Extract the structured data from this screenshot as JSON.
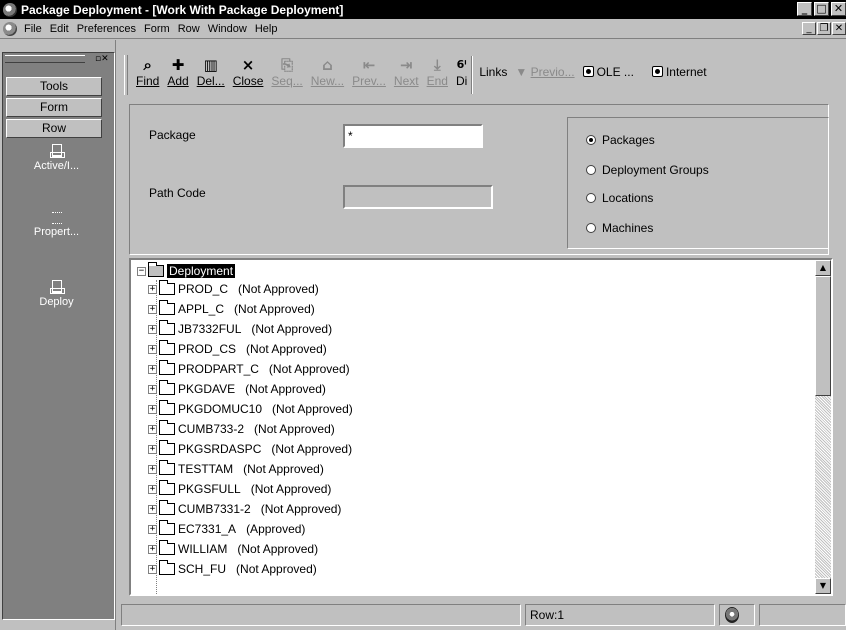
{
  "window": {
    "title": "Package Deployment - [Work With Package Deployment]"
  },
  "menu": [
    "File",
    "Edit",
    "Preferences",
    "Form",
    "Row",
    "Window",
    "Help"
  ],
  "exit_bar": {
    "tabs": [
      "Tools",
      "Form",
      "Row"
    ],
    "items": [
      "Active/I...",
      "Propert...",
      "Deploy"
    ]
  },
  "toolbar": {
    "buttons": [
      {
        "label": "Find",
        "icon": "find-icon",
        "enabled": true
      },
      {
        "label": "Add",
        "icon": "add-icon",
        "enabled": true
      },
      {
        "label": "Del...",
        "icon": "delete-icon",
        "enabled": true
      },
      {
        "label": "Close",
        "icon": "close-icon",
        "enabled": true
      },
      {
        "label": "Seq...",
        "icon": "sequence-icon",
        "enabled": false
      },
      {
        "label": "New...",
        "icon": "new-icon",
        "enabled": false
      },
      {
        "label": "Prev...",
        "icon": "prev-icon",
        "enabled": false
      },
      {
        "label": "Next",
        "icon": "next-icon",
        "enabled": false
      },
      {
        "label": "End",
        "icon": "end-icon",
        "enabled": false
      },
      {
        "label": "Di",
        "icon": "display-icon",
        "enabled": true
      }
    ],
    "links_label": "Links",
    "links_prev": "Previo...",
    "ole_label": "OLE ...",
    "internet_label": "Internet"
  },
  "form": {
    "package_label": "Package",
    "package_value": "*",
    "path_code_label": "Path Code",
    "path_code_value": "",
    "radio_options": [
      {
        "label": "Packages",
        "selected": true
      },
      {
        "label": "Deployment Groups",
        "selected": false
      },
      {
        "label": "Locations",
        "selected": false
      },
      {
        "label": "Machines",
        "selected": false
      }
    ]
  },
  "tree": {
    "root": "Deployment",
    "items": [
      {
        "name": "PROD_C",
        "status": "(Not Approved)"
      },
      {
        "name": "APPL_C",
        "status": "(Not Approved)"
      },
      {
        "name": "JB7332FUL",
        "status": "(Not Approved)"
      },
      {
        "name": "PROD_CS",
        "status": "(Not Approved)"
      },
      {
        "name": "PRODPART_C",
        "status": "(Not Approved)"
      },
      {
        "name": "PKGDAVE",
        "status": "(Not Approved)"
      },
      {
        "name": "PKGDOMUC10",
        "status": "(Not Approved)"
      },
      {
        "name": "CUMB733-2",
        "status": "(Not Approved)"
      },
      {
        "name": "PKGSRDASPC",
        "status": "(Not Approved)"
      },
      {
        "name": "TESTTAM",
        "status": "(Not Approved)"
      },
      {
        "name": "PKGSFULL",
        "status": "(Not Approved)"
      },
      {
        "name": "CUMB7331-2",
        "status": "(Not Approved)"
      },
      {
        "name": "EC7331_A",
        "status": "(Approved)"
      },
      {
        "name": "WILLIAM",
        "status": "(Not Approved)"
      },
      {
        "name": "SCH_FU",
        "status": "(Not Approved)"
      }
    ]
  },
  "status_bar": {
    "row_text": "Row:1"
  }
}
